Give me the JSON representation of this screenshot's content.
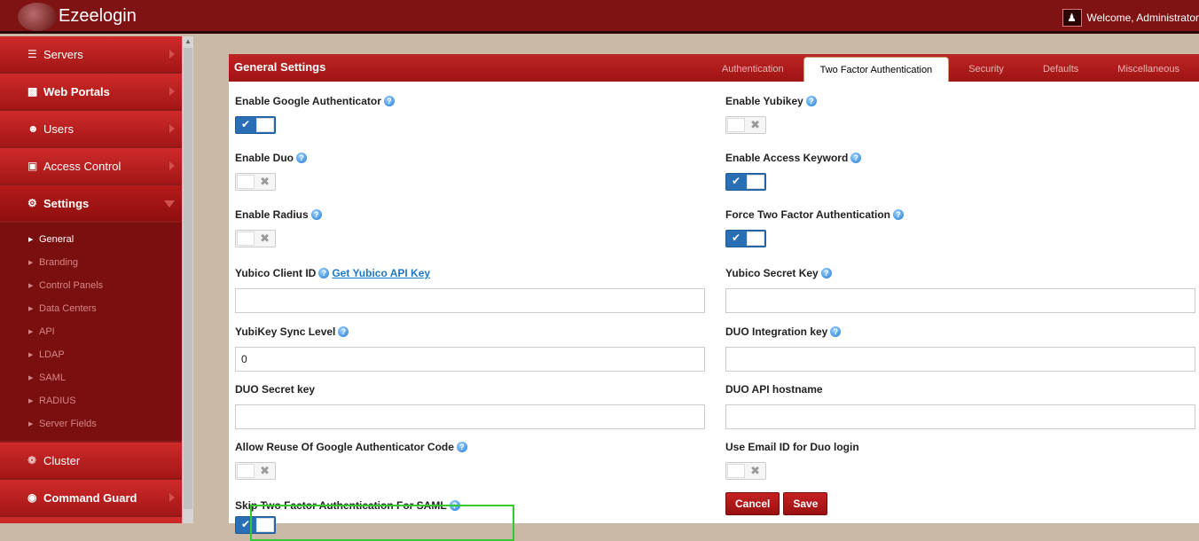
{
  "topbar": {
    "brand": "Ezeelogin",
    "welcome": "Welcome, Administrator"
  },
  "sidebar": {
    "items": [
      {
        "label": "Servers",
        "icon": "list-icon"
      },
      {
        "label": "Web Portals",
        "icon": "grid-icon"
      },
      {
        "label": "Users",
        "icon": "users-icon"
      },
      {
        "label": "Access Control",
        "icon": "lock-icon"
      },
      {
        "label": "Settings",
        "icon": "cogs-icon"
      }
    ],
    "sub_items": [
      "General",
      "Branding",
      "Control Panels",
      "Data Centers",
      "API",
      "LDAP",
      "SAML",
      "RADIUS",
      "Server Fields"
    ],
    "bottom_items": [
      {
        "label": "Cluster",
        "icon": "cluster-icon"
      },
      {
        "label": "Command Guard",
        "icon": "shield-icon"
      }
    ]
  },
  "panel": {
    "title": "General Settings",
    "tabs": [
      "Authentication",
      "Two Factor Authentication",
      "Security",
      "Defaults",
      "Miscellaneous"
    ],
    "left": {
      "google_auth": "Enable Google Authenticator",
      "duo": "Enable Duo",
      "radius": "Enable Radius",
      "yubico_client_id": "Yubico Client ID",
      "yubico_api_link": "Get Yubico API Key",
      "yubikey_sync": "YubiKey Sync Level",
      "yubikey_sync_value": "0",
      "duo_secret": "DUO Secret key",
      "reuse_google": "Allow Reuse Of Google Authenticator Code",
      "skip_saml": "Skip Two Factor Authentication For SAML"
    },
    "right": {
      "yubikey": "Enable Yubikey",
      "access_keyword": "Enable Access Keyword",
      "force_2fa": "Force Two Factor Authentication",
      "yubico_secret": "Yubico Secret Key",
      "duo_integration": "DUO Integration key",
      "duo_api_host": "DUO API hostname",
      "email_duo": "Use Email ID for Duo login"
    },
    "buttons": {
      "cancel": "Cancel",
      "save": "Save"
    }
  }
}
